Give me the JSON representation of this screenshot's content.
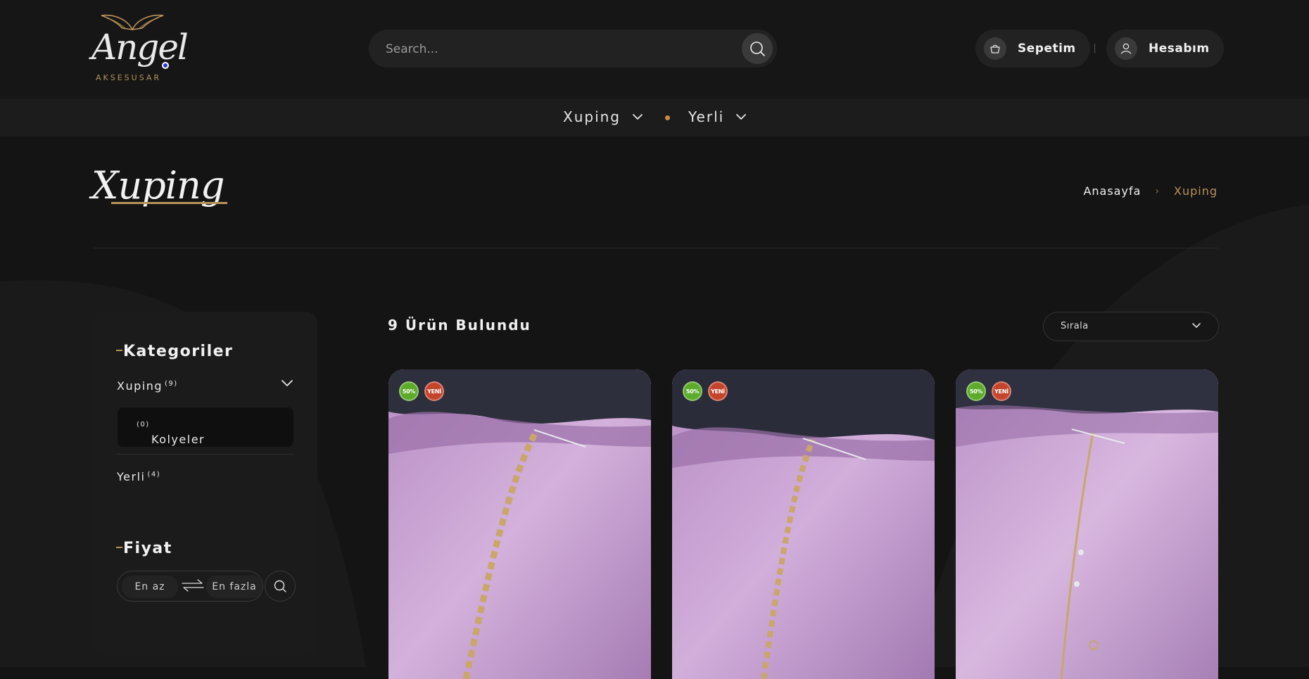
{
  "header": {
    "logo_text": "Angel",
    "logo_subtext": "AKSESUSAR",
    "search_placeholder": "Search...",
    "cart_label": "Sepetim",
    "account_label": "Hesabım"
  },
  "nav": {
    "items": [
      {
        "label": "Xuping"
      },
      {
        "label": "Yerli"
      }
    ]
  },
  "page": {
    "title": "Xuping",
    "breadcrumb": {
      "home": "Anasayfa",
      "separator": "›",
      "current": "Xuping"
    }
  },
  "sidebar": {
    "categories_title": "Kategoriler",
    "categories": [
      {
        "label": "Xuping",
        "count": "(9)"
      },
      {
        "label": "Kolyeler",
        "count": "(0)"
      },
      {
        "label": "Yerli",
        "count": "(4)"
      }
    ],
    "price_title": "Fiyat",
    "price_min_placeholder": "En az",
    "price_max_placeholder": "En fazla"
  },
  "products": {
    "count_label": "9 Ürün Bulundu",
    "sort_label": "Sırala",
    "items": [
      {
        "badge_sale": "50%",
        "badge_new": "YENİ"
      },
      {
        "badge_sale": "50%",
        "badge_new": "YENİ"
      },
      {
        "badge_sale": "50%",
        "badge_new": "YENİ"
      }
    ]
  },
  "colors": {
    "accent_gold": "#b8925a",
    "background": "#141414",
    "sale_badge": "#5dab2b",
    "new_badge": "#c4452c"
  }
}
